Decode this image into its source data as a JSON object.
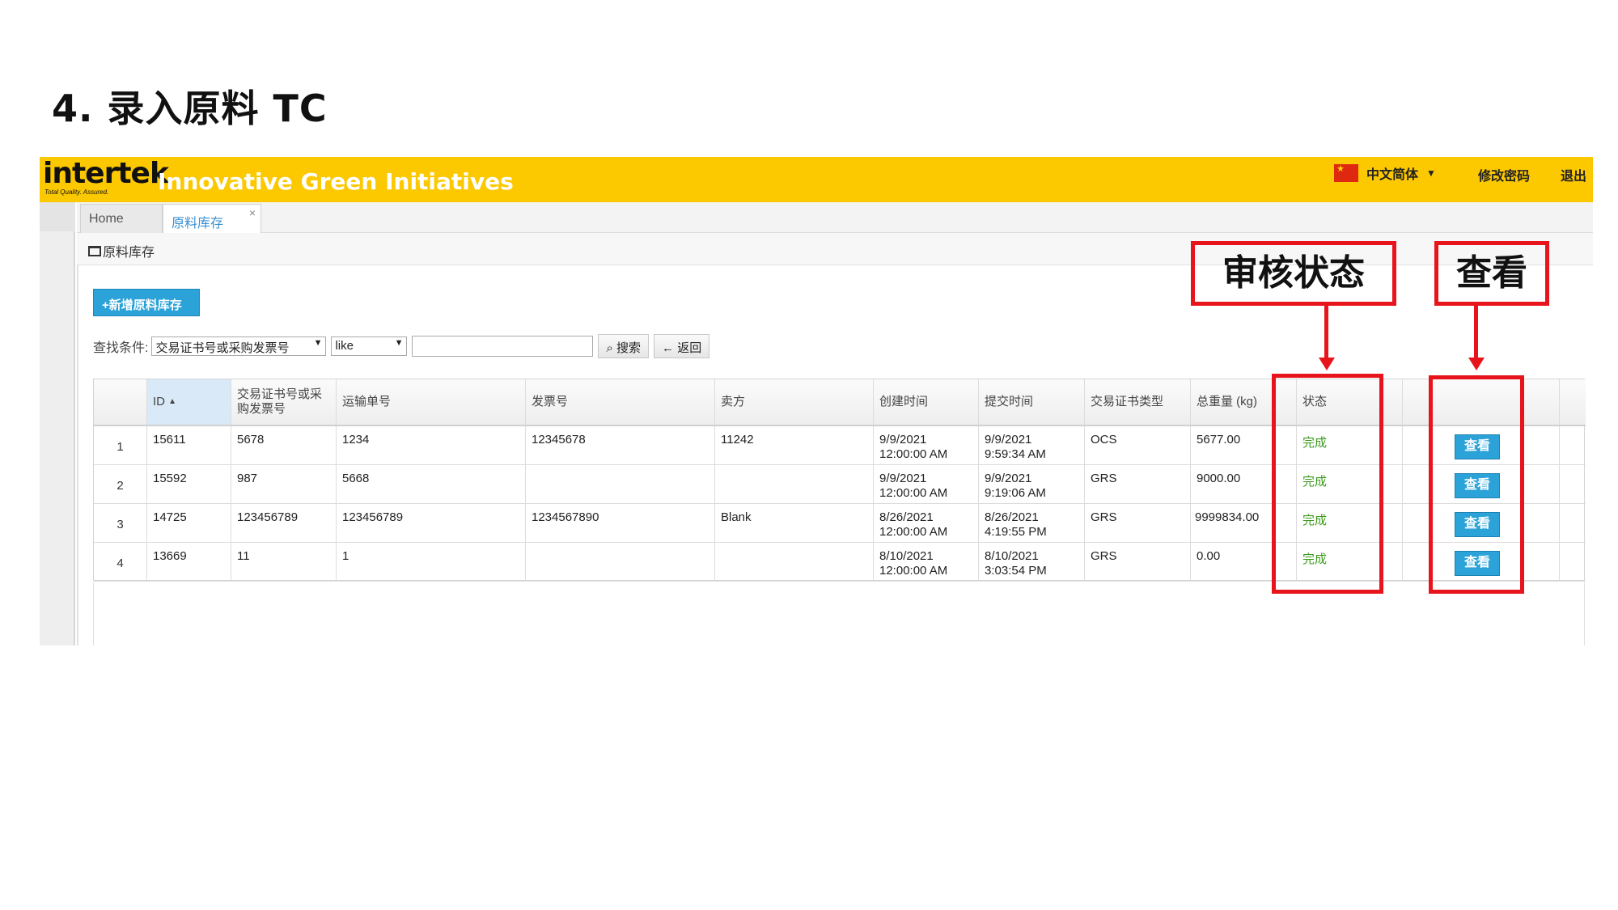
{
  "slide": {
    "title": "4. 录入原料 TC"
  },
  "header": {
    "logo_text": "intertek",
    "logo_tagline": "Total Quality. Assured.",
    "app_title": "Innovative Green Initiatives",
    "language": "中文简体",
    "change_password": "修改密码",
    "logout": "退出",
    "bar_color": "#fcc800"
  },
  "tabs": [
    {
      "label": "Home"
    },
    {
      "label": "原料库存",
      "close": "×"
    }
  ],
  "panel": {
    "title": "原料库存"
  },
  "toolbar": {
    "add_label": "+新增原料库存"
  },
  "search": {
    "label": "查找条件:",
    "field_value": "交易证书号或采购发票号",
    "operator_value": "like",
    "input_value": "",
    "search_label": "搜索",
    "back_label": "返回"
  },
  "table": {
    "columns": [
      "ID",
      "交易证书号或采购发票号",
      "运输单号",
      "发票号",
      "卖方",
      "创建时间",
      "提交时间",
      "交易证书类型",
      "总重量 (kg)",
      "状态"
    ],
    "sort_indicator": "▲",
    "rows": [
      {
        "num": "1",
        "id": "15611",
        "cert": "5678",
        "ship": "1234",
        "invoice": "12345678",
        "seller": "11242",
        "created_date": "9/9/2021",
        "created_time": "12:00:00 AM",
        "submitted_date": "9/9/2021",
        "submitted_time": "9:59:34 AM",
        "type": "OCS",
        "weight": "5677.00",
        "status": "完成",
        "action": "查看"
      },
      {
        "num": "2",
        "id": "15592",
        "cert": "987",
        "ship": "5668",
        "invoice": "",
        "seller": "",
        "created_date": "9/9/2021",
        "created_time": "12:00:00 AM",
        "submitted_date": "9/9/2021",
        "submitted_time": "9:19:06 AM",
        "type": "GRS",
        "weight": "9000.00",
        "status": "完成",
        "action": "查看"
      },
      {
        "num": "3",
        "id": "14725",
        "cert": "123456789",
        "ship": "123456789",
        "invoice": "1234567890",
        "seller": "Blank",
        "created_date": "8/26/2021",
        "created_time": "12:00:00 AM",
        "submitted_date": "8/26/2021",
        "submitted_time": "4:19:55 PM",
        "type": "GRS",
        "weight": "9999834.00",
        "status": "完成",
        "action": "查看"
      },
      {
        "num": "4",
        "id": "13669",
        "cert": "11",
        "ship": "1",
        "invoice": "",
        "seller": "",
        "created_date": "8/10/2021",
        "created_time": "12:00:00 AM",
        "submitted_date": "8/10/2021",
        "submitted_time": "3:03:54 PM",
        "type": "GRS",
        "weight": "0.00",
        "status": "完成",
        "action": "查看"
      }
    ]
  },
  "annotations": {
    "status_label": "审核状态",
    "view_label": "查看",
    "color": "#e8141b"
  }
}
